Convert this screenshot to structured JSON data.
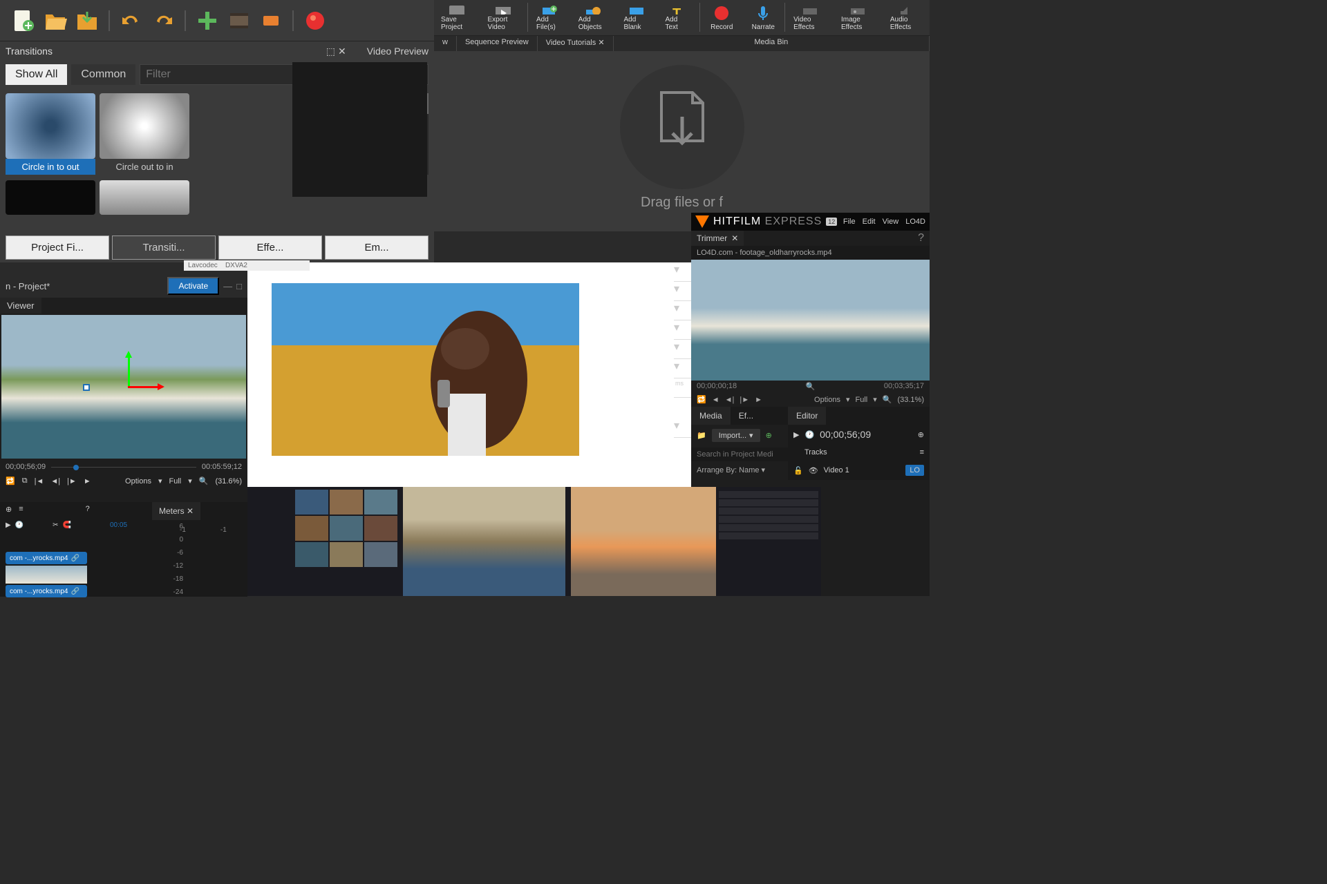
{
  "openshot": {
    "panels": {
      "transitions": "Transitions",
      "preview": "Video Preview"
    },
    "filter_tabs": {
      "show_all": "Show All",
      "common": "Common"
    },
    "filter_placeholder": "Filter",
    "thumbs": [
      {
        "label": "Circle in to out",
        "selected": true
      },
      {
        "label": "Circle out to in",
        "selected": false
      }
    ],
    "tabs": [
      "Project Fi...",
      "Transiti...",
      "Effe...",
      "Em..."
    ]
  },
  "videopad": {
    "tools": [
      {
        "label": "Save Project",
        "color": "#999"
      },
      {
        "label": "Export Video",
        "color": "#999"
      },
      {
        "label": "Add File(s)",
        "color": "#3aa0e8"
      },
      {
        "label": "Add Objects",
        "color": "#3aa0e8"
      },
      {
        "label": "Add Blank",
        "color": "#3aa0e8"
      },
      {
        "label": "Add Text",
        "color": "#e8c030"
      },
      {
        "label": "Record",
        "color": "#e83030"
      },
      {
        "label": "Narrate",
        "color": "#3aa0e8"
      },
      {
        "label": "Video Effects",
        "color": "#888"
      },
      {
        "label": "Image Effects",
        "color": "#888"
      },
      {
        "label": "Audio Effects",
        "color": "#888"
      }
    ],
    "tabs": {
      "w": "w",
      "seq": "Sequence Preview",
      "tut": "Video Tutorials",
      "bin": "Media Bin"
    },
    "drop_text": "Drag files or f"
  },
  "hitfilm": {
    "brand": {
      "name": "HITFILM",
      "edition": "EXPRESS",
      "badge": "12"
    },
    "menu": [
      "File",
      "Edit",
      "View"
    ],
    "menu_right": "LO4D",
    "trimmer": {
      "tab": "Trimmer",
      "filename": "LO4D.com - footage_oldharryrocks.mp4",
      "tc_in": "00;00;00;18",
      "tc_out": "00;03;35;17"
    },
    "controls": {
      "options": "Options",
      "full": "Full",
      "zoom": "(33.1%)"
    },
    "panel_tabs": {
      "media": "Media",
      "ef": "Ef...",
      "editor": "Editor"
    },
    "import": "Import...",
    "search_placeholder": "Search in Project Medi",
    "arrange": "Arrange By: Name",
    "editor": {
      "timecode": "00;00;56;09",
      "tracks_label": "Tracks",
      "video1": "Video 1",
      "lo_badge": "LO"
    }
  },
  "hf_viewer": {
    "title": "n - Project*",
    "activate": "Activate",
    "tab": "Viewer",
    "tc_in": "00;00;56;09",
    "tc_out": "00:05:59;12",
    "options": "Options",
    "full": "Full",
    "zoom": "(31.6%)"
  },
  "hf_tracks": {
    "meters_tab": "Meters",
    "ruler": "00:05",
    "clips": [
      "com -...yrocks.mp4",
      "com -...yrocks.mp4"
    ],
    "meter_levels": [
      "-1",
      "-1"
    ],
    "meter_scale": [
      "6",
      "0",
      "-6",
      "-12",
      "-18",
      "-24"
    ]
  },
  "center": {
    "decoder1": "Lavcodec",
    "decoder2": "DXVA2",
    "ms": "ms"
  }
}
